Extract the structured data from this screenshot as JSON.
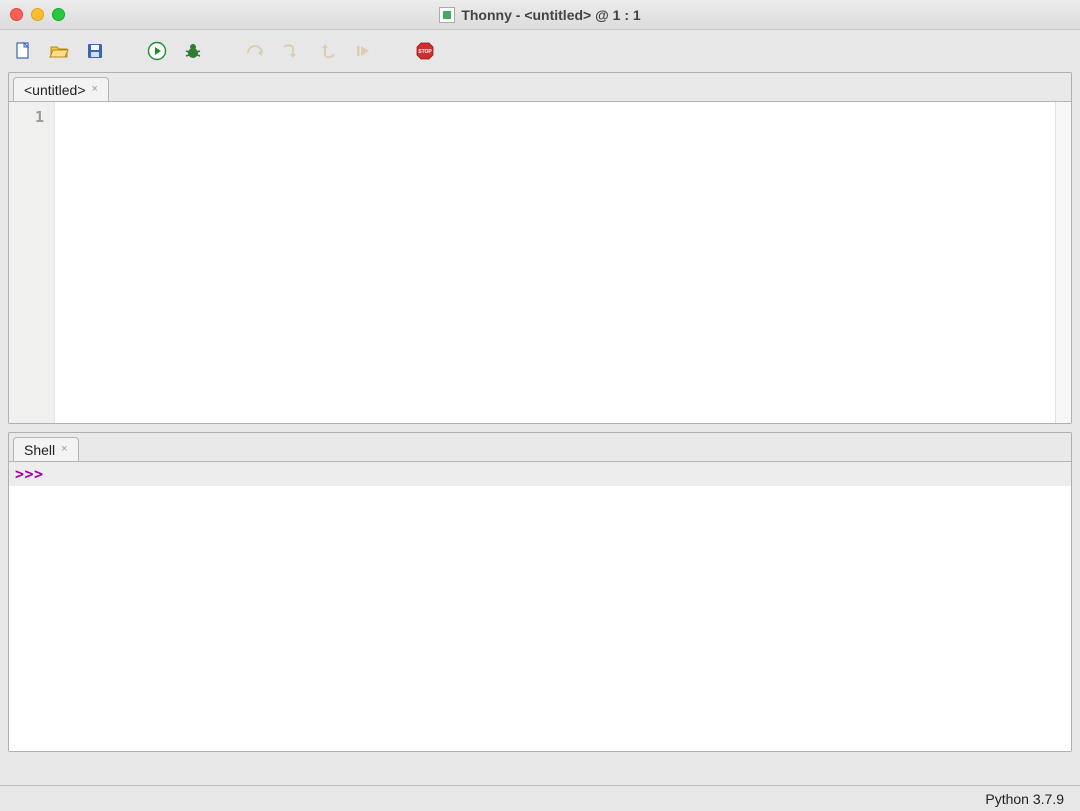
{
  "window": {
    "title": "Thonny  -  <untitled>  @  1 : 1"
  },
  "toolbar": {
    "new": {
      "name": "new-file-icon"
    },
    "open": {
      "name": "open-file-icon"
    },
    "save": {
      "name": "save-file-icon"
    },
    "run": {
      "name": "run-icon"
    },
    "debug": {
      "name": "debug-icon"
    },
    "step_over": {
      "name": "step-over-icon"
    },
    "step_into": {
      "name": "step-into-icon"
    },
    "step_out": {
      "name": "step-out-icon"
    },
    "resume": {
      "name": "resume-icon"
    },
    "stop": {
      "name": "stop-icon"
    }
  },
  "editor": {
    "tab_label": "<untitled>",
    "line_numbers": [
      "1"
    ],
    "content": ""
  },
  "shell": {
    "tab_label": "Shell",
    "prompt": ">>>"
  },
  "statusbar": {
    "interpreter": "Python 3.7.9"
  }
}
